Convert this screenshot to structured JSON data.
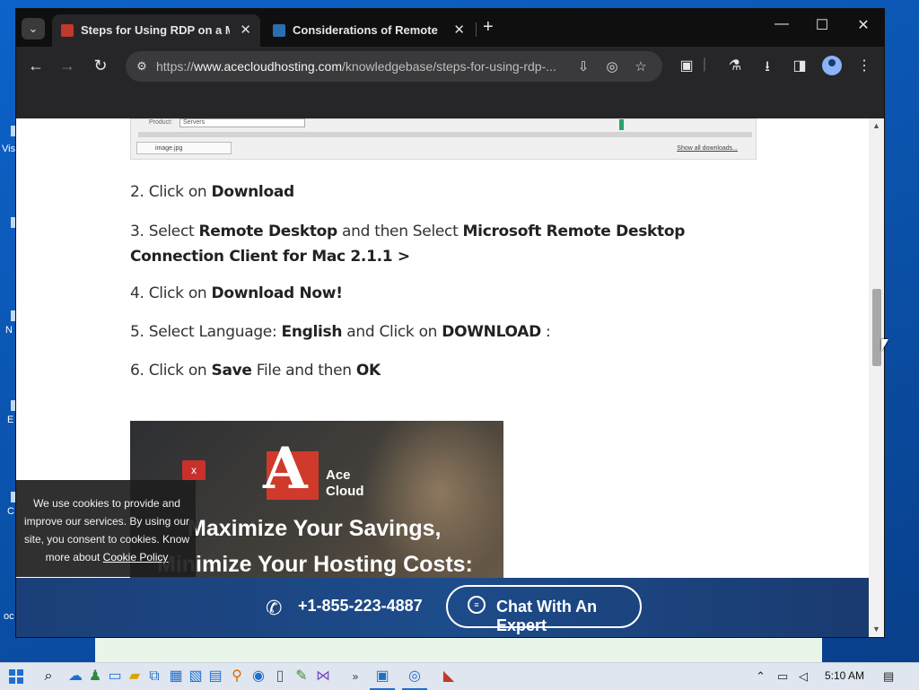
{
  "browser": {
    "tabs": [
      {
        "title": "Steps for Using RDP on a MAC",
        "active": true,
        "favicon_color": "#c0392b"
      },
      {
        "title": "Considerations of Remote Prin",
        "active": false,
        "favicon_color": "#2a6fb0"
      }
    ],
    "close_glyph": "✕",
    "new_tab_glyph": "+",
    "tab_list_glyph": "⌄",
    "window_controls": {
      "minimize": "—",
      "maximize": "☐",
      "close": "✕"
    },
    "url_scheme": "https://",
    "url_host": "www.acecloudhosting.com",
    "url_path": "/knowledgebase/steps-for-using-rdp-...",
    "nav": {
      "back": "←",
      "forward": "→",
      "reload": "↻"
    }
  },
  "page": {
    "screenshot_snippet": {
      "product_label": "Product:",
      "product_value": "Servers",
      "download_file": "image.jpg",
      "show_all": "Show all downloads..."
    },
    "steps": [
      {
        "prefix": "2. Click on ",
        "bold1": "Download",
        "mid": "",
        "bold2": "",
        "suffix": ""
      },
      {
        "prefix": "3. Select ",
        "bold1": "Remote Desktop",
        "mid": " and then Select ",
        "bold2": "Microsoft Remote Desktop Connection Client for Mac 2.1.1 >",
        "suffix": ""
      },
      {
        "prefix": "4. Click on ",
        "bold1": "Download Now!",
        "mid": "",
        "bold2": "",
        "suffix": ""
      },
      {
        "prefix": "5. Select Language: ",
        "bold1": "English",
        "mid": " and Click on ",
        "bold2": "DOWNLOAD",
        "suffix": " :"
      },
      {
        "prefix": "6. Click on ",
        "bold1": "Save",
        "mid": " File and then ",
        "bold2": "OK",
        "suffix": ""
      }
    ],
    "banner": {
      "logo_letter": "A",
      "logo_line1": "Ace",
      "logo_line2": "Cloud",
      "headline1": "Maximize Your Savings,",
      "headline2": "Minimize Your Hosting Costs:"
    },
    "cookie": {
      "close": "x",
      "message": "We use cookies to provide and improve our services. By using our site, you consent to cookies. Know more about",
      "link": "Cookie Policy"
    },
    "cta": {
      "phone": "+1-855-223-4887",
      "chat": "Chat With An Expert"
    }
  },
  "desktop": {
    "labels": [
      "Vis",
      "N",
      "E",
      "C",
      "oc"
    ]
  },
  "taskbar": {
    "clock": "5:10 AM",
    "overflow": "»"
  },
  "colors": {
    "accent_red": "#cf3a2b",
    "cta_bar": "#1d4c8a",
    "chrome_dark": "#262628"
  }
}
